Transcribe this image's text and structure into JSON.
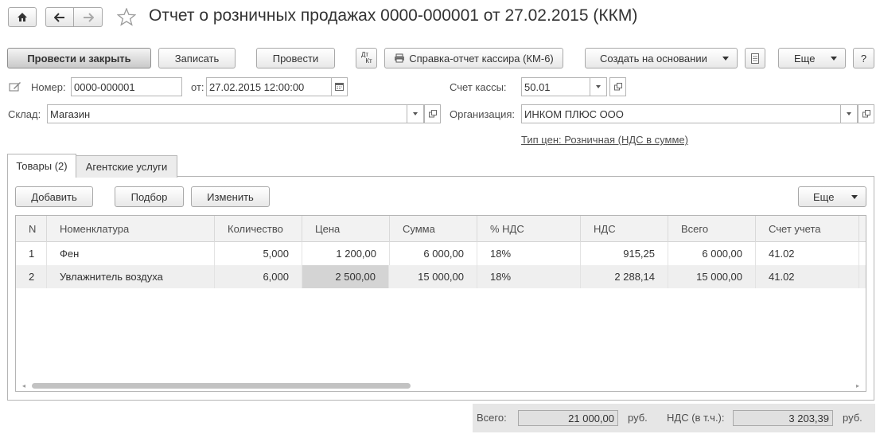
{
  "window": {
    "title": "Отчет о розничных продажах 0000-000001 от 27.02.2015 (ККМ)"
  },
  "toolbar": {
    "post_and_close": "Провести и закрыть",
    "save": "Записать",
    "post": "Провести",
    "dt_kt_top": "Дт",
    "dt_kt_bottom": "Кт",
    "cashier_report": "Справка-отчет кассира (КМ-6)",
    "create_based_on": "Создать на основании",
    "more": "Еще",
    "help": "?"
  },
  "header": {
    "number_label": "Номер:",
    "number_value": "0000-000001",
    "date_label": "от:",
    "date_value": "27.02.2015 12:00:00",
    "cash_account_label": "Счет кассы:",
    "cash_account_value": "50.01",
    "warehouse_label": "Склад:",
    "warehouse_value": "Магазин",
    "organization_label": "Организация:",
    "organization_value": "ИНКОМ ПЛЮС ООО",
    "price_type_link": "Тип цен: Розничная (НДС в сумме)"
  },
  "tabs": [
    {
      "label": "Товары (2)",
      "active": true
    },
    {
      "label": "Агентские услуги",
      "active": false
    }
  ],
  "table_toolbar": {
    "add": "Добавить",
    "selection": "Подбор",
    "change": "Изменить",
    "more": "Еще"
  },
  "table": {
    "columns": [
      "N",
      "Номенклатура",
      "Количество",
      "Цена",
      "Сумма",
      "% НДС",
      "НДС",
      "Всего",
      "Счет учета"
    ],
    "rows": [
      [
        "1",
        "Фен",
        "5,000",
        "1 200,00",
        "6 000,00",
        "18%",
        "915,25",
        "6 000,00",
        "41.02"
      ],
      [
        "2",
        "Увлажнитель воздуха",
        "6,000",
        "2 500,00",
        "15 000,00",
        "18%",
        "2 288,14",
        "15 000,00",
        "41.02"
      ]
    ]
  },
  "footer": {
    "total_label": "Всего:",
    "total_value": "21 000,00",
    "total_currency": "руб.",
    "vat_label": "НДС (в т.ч.):",
    "vat_value": "3 203,39",
    "vat_currency": "руб."
  }
}
